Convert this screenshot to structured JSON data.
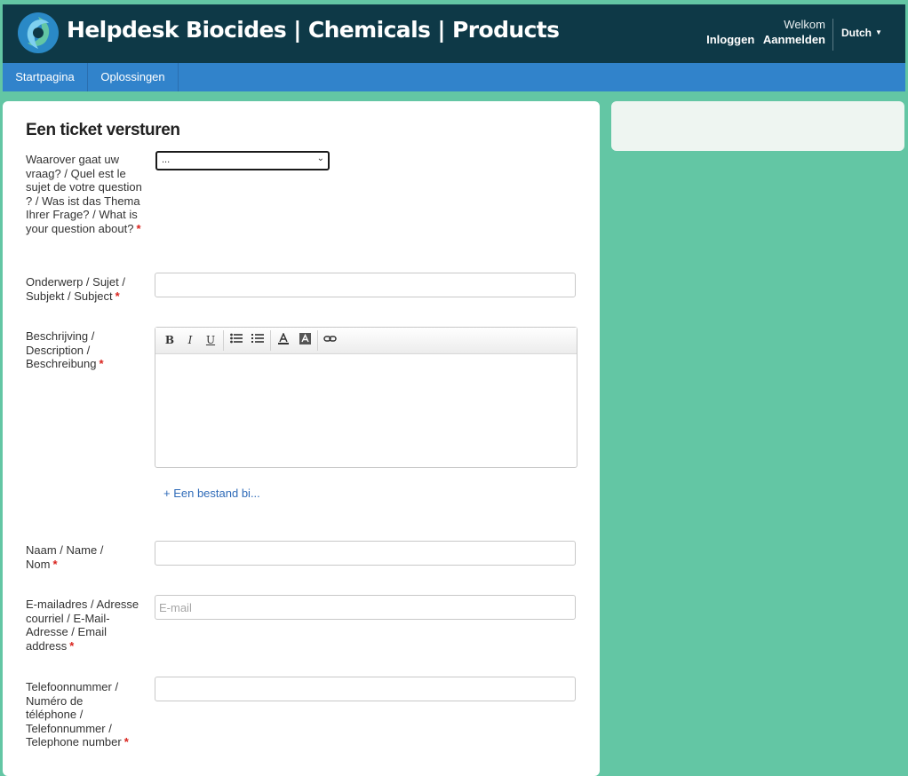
{
  "header": {
    "title": "Helpdesk Biocides | Chemicals | Products",
    "welcome": "Welkom",
    "login": "Inloggen",
    "register": "Aanmelden",
    "language": "Dutch"
  },
  "nav": {
    "items": [
      "Startpagina",
      "Oplossingen"
    ]
  },
  "form": {
    "title": "Een ticket versturen",
    "topic_label": "Waarover gaat uw vraag? / Quel est le sujet de votre question ? / Was ist das Thema Ihrer Frage? / What is your question about?",
    "topic_value": "...",
    "subject_label": "Onderwerp / Sujet / Subjekt / Subject",
    "description_label": "Beschrijving / Description / Beschreibung",
    "attach_link": "+ Een bestand bi...",
    "name_label": "Naam / Name / Nom",
    "email_label": "E-mailadres / Adresse courriel / E-Mail-Adresse / Email address",
    "email_placeholder": "E-mail",
    "phone_label": "Telefoonnummer / Numéro de téléphone / Telefonnummer / Telephone number",
    "required_marker": "*"
  },
  "editor_toolbar": {
    "bold": "B",
    "italic": "I",
    "underline": "U"
  },
  "colors": {
    "background": "#63c6a4",
    "header": "#0e3947",
    "nav": "#3183cb",
    "required": "#d9231d",
    "link": "#2f6bb8"
  }
}
